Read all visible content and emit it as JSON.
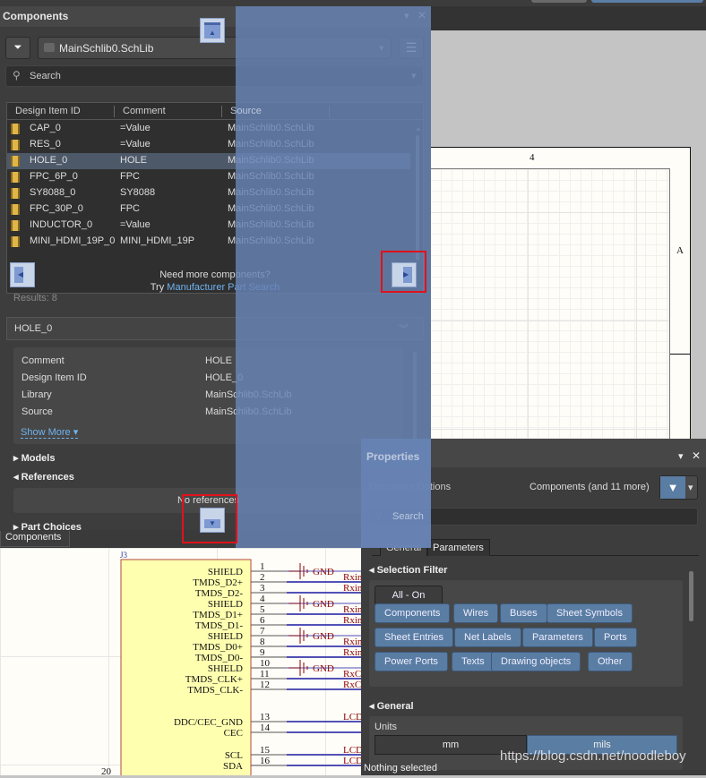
{
  "sheet": {
    "zone_col": "4",
    "zone_row": "A"
  },
  "components": {
    "title": "Components",
    "library": "MainSchlib0.SchLib",
    "search_placeholder": "Search",
    "columns": [
      "Design Item ID",
      "Comment",
      "Source"
    ],
    "rows": [
      {
        "id": "CAP_0",
        "comment": "=Value",
        "source": "MainSchlib0.SchLib"
      },
      {
        "id": "RES_0",
        "comment": "=Value",
        "source": "MainSchlib0.SchLib"
      },
      {
        "id": "HOLE_0",
        "comment": "HOLE",
        "source": "MainSchlib0.SchLib",
        "selected": true
      },
      {
        "id": "FPC_6P_0",
        "comment": "FPC",
        "source": "MainSchlib0.SchLib"
      },
      {
        "id": "SY8088_0",
        "comment": "SY8088",
        "source": "MainSchlib0.SchLib"
      },
      {
        "id": "FPC_30P_0",
        "comment": "FPC",
        "source": "MainSchlib0.SchLib"
      },
      {
        "id": "INDUCTOR_0",
        "comment": "=Value",
        "source": "MainSchlib0.SchLib"
      },
      {
        "id": "MINI_HDMI_19P_0",
        "comment": "MINI_HDMI_19P",
        "source": "MainSchlib0.SchLib"
      }
    ],
    "need_more": "Need more components?",
    "try": "Try",
    "mps_link": "Manufacturer Part Search",
    "results": "Results: 8",
    "detail": {
      "title": "HOLE_0",
      "props": [
        {
          "k": "Comment",
          "v": "HOLE"
        },
        {
          "k": "Design Item ID",
          "v": "HOLE_0"
        },
        {
          "k": "Library",
          "v": "MainSchlib0.SchLib"
        },
        {
          "k": "Source",
          "v": "MainSchlib0.SchLib"
        }
      ],
      "show_more": "Show More",
      "models": "Models",
      "references": "References",
      "no_refs": "No references",
      "part_choices": "Part Choices"
    },
    "bottom_tab": "Components"
  },
  "properties": {
    "title": "Properties",
    "doc_options": "Document Options",
    "filter_summary": "Components (and 11 more)",
    "search_placeholder": "Search",
    "tabs": [
      "General",
      "Parameters"
    ],
    "selection_filter": "Selection Filter",
    "all_on": "All - On",
    "filters": [
      "Components",
      "Wires",
      "Buses",
      "Sheet Symbols",
      "Sheet Entries",
      "Net Labels",
      "Parameters",
      "Ports",
      "Power Ports",
      "Texts",
      "Drawing objects",
      "Other"
    ],
    "general": "General",
    "units_label": "Units",
    "units": [
      "mm",
      "mils"
    ],
    "units_selected": "mils",
    "status": "Nothing selected"
  },
  "schematic": {
    "designator": "J3",
    "pins": [
      {
        "n": "1",
        "name": "SHIELD",
        "gnd": true
      },
      {
        "n": "2",
        "name": "TMDS_D2+",
        "net": "Rxin"
      },
      {
        "n": "3",
        "name": "TMDS_D2-",
        "net": "Rxin"
      },
      {
        "n": "4",
        "name": "SHIELD",
        "gnd": true
      },
      {
        "n": "5",
        "name": "TMDS_D1+",
        "net": "Rxin"
      },
      {
        "n": "6",
        "name": "TMDS_D1-",
        "net": "Rxin"
      },
      {
        "n": "7",
        "name": "SHIELD",
        "gnd": true
      },
      {
        "n": "8",
        "name": "TMDS_D0+",
        "net": "Rxin"
      },
      {
        "n": "9",
        "name": "TMDS_D0-",
        "net": "Rxin"
      },
      {
        "n": "10",
        "name": "SHIELD",
        "gnd": true
      },
      {
        "n": "11",
        "name": "TMDS_CLK+",
        "net": "RxC"
      },
      {
        "n": "12",
        "name": "TMDS_CLK-",
        "net": "RxC"
      },
      {
        "n": "13",
        "name": "DDC/CEC_GND",
        "net": "LCD"
      },
      {
        "n": "14",
        "name": "CEC"
      },
      {
        "n": "15",
        "name": "SCL",
        "net": "LCD"
      },
      {
        "n": "16",
        "name": "SDA",
        "net": "LCD"
      }
    ],
    "gnd_label": "GND",
    "pin20": "20"
  },
  "watermark": "https://blog.csdn.net/noodleboy",
  "colors": {
    "accent": "#5a7da3",
    "overlay": "#6884b6",
    "wire": "#1a1aa0",
    "pin_body": "#ffffb0",
    "net_label": "#8b0000"
  }
}
